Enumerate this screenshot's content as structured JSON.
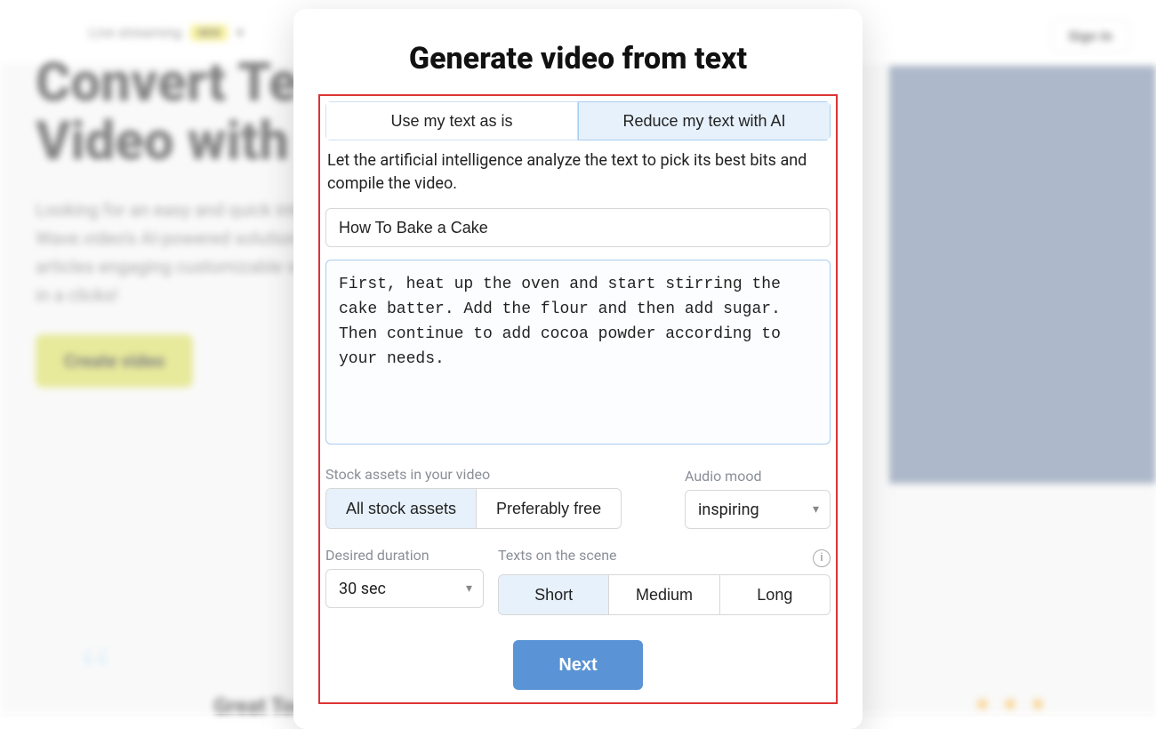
{
  "background": {
    "nav_item": "Live streaming",
    "nav_badge": "NEW",
    "sign_in": "Sign In",
    "hero_line1": "Convert Te",
    "hero_line2": "Video with",
    "hero_para": "Looking for an easy and quick into video online? You are in Wave.video's AI-powered solution converting blog posts, articles engaging customizable video Create videos from text in a clicks!",
    "cta": "Create video",
    "testimonial": "Great Tool for Social Media Videos",
    "stars": "★ ★ ★"
  },
  "modal": {
    "title": "Generate video from text",
    "tabs": {
      "use_text": "Use my text as is",
      "reduce_ai": "Reduce my text with AI"
    },
    "description": "Let the artificial intelligence analyze the text to pick its best bits and compile the video.",
    "title_input": "How To Bake a Cake",
    "body_text": "First, heat up the oven and start stirring the cake batter. Add the flour and then add sugar. Then continue to add cocoa powder according to your needs.",
    "stock": {
      "label": "Stock assets in your video",
      "options": {
        "all": "All stock assets",
        "free": "Preferably free"
      }
    },
    "audio": {
      "label": "Audio mood",
      "value": "inspiring"
    },
    "duration": {
      "label": "Desired duration",
      "value": "30 sec"
    },
    "texts": {
      "label": "Texts on the scene",
      "options": {
        "short": "Short",
        "medium": "Medium",
        "long": "Long"
      }
    },
    "next": "Next"
  }
}
